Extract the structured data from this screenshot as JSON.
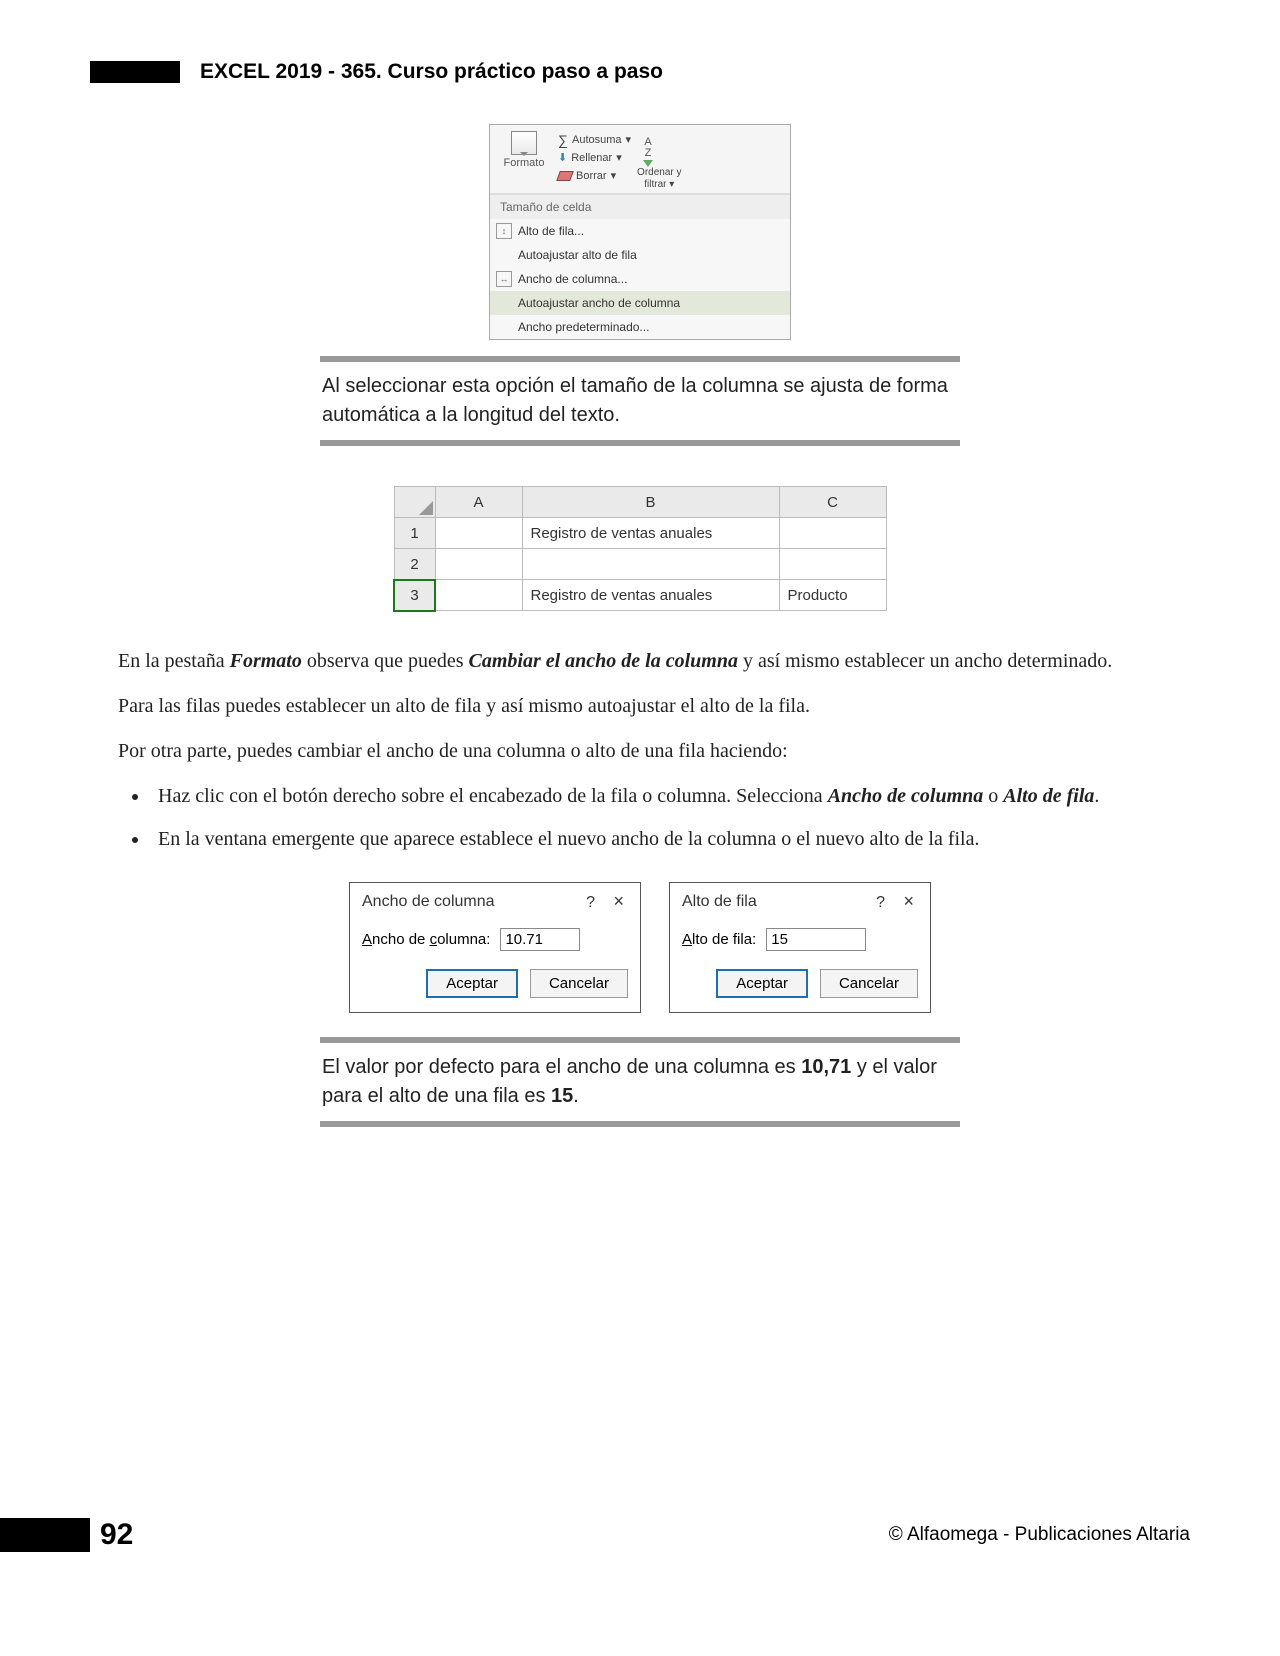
{
  "header": {
    "title": "EXCEL 2019 - 365. Curso práctico paso a paso"
  },
  "ribbon": {
    "formato_label": "Formato",
    "autosuma": "Autosuma",
    "rellenar": "Rellenar",
    "borrar": "Borrar",
    "ordenar_filtrar_l1": "Ordenar y",
    "ordenar_filtrar_l2": "filtrar",
    "section": "Tamaño de celda",
    "items": [
      "Alto de fila...",
      "Autoajustar alto de fila",
      "Ancho de columna...",
      "Autoajustar ancho de columna",
      "Ancho predeterminado..."
    ]
  },
  "note1": "Al seleccionar esta opción el tamaño de la columna se ajusta de forma automática a la longitud del texto.",
  "sheet": {
    "cols": [
      "A",
      "B",
      "C"
    ],
    "rows": [
      {
        "num": "1",
        "A": "",
        "B": "Registro de ventas anuales",
        "C": ""
      },
      {
        "num": "2",
        "A": "",
        "B": "",
        "C": ""
      },
      {
        "num": "3",
        "A": "",
        "B": "Registro de ventas anuales",
        "C": "Producto"
      }
    ]
  },
  "para1_a": "En la pestaña ",
  "para1_b": "Formato",
  "para1_c": " observa que puedes ",
  "para1_d": "Cambiar el ancho de la columna",
  "para1_e": " y así mismo establecer un ancho determinado.",
  "para2": "Para las filas puedes establecer un alto de fila y así mismo autoajustar el alto de la fila.",
  "para3": "Por otra parte, puedes cambiar el ancho de una columna o alto de una fila haciendo:",
  "bullets": {
    "b1_a": "Haz clic con el botón derecho sobre el encabezado de la fila o columna. Selecciona ",
    "b1_b": "Ancho de columna",
    "b1_c": " o ",
    "b1_d": "Alto de fila",
    "b1_e": ".",
    "b2": "En la ventana emergente que aparece establece el nuevo ancho de la columna o el nuevo alto de la fila."
  },
  "dlg_ancho": {
    "title": "Ancho de columna",
    "label": "Ancho de columna:",
    "value": "10.71",
    "ok": "Aceptar",
    "cancel": "Cancelar"
  },
  "dlg_alto": {
    "title": "Alto de fila",
    "label": "Alto de fila:",
    "value": "15",
    "ok": "Aceptar",
    "cancel": "Cancelar"
  },
  "note2_a": "El valor por defecto para el ancho de una columna es ",
  "note2_b": "10,71",
  "note2_c": " y el valor para el alto de una fila es ",
  "note2_d": "15",
  "note2_e": ".",
  "footer": {
    "page": "92",
    "copyright": "© Alfaomega - Publicaciones Altaria"
  }
}
